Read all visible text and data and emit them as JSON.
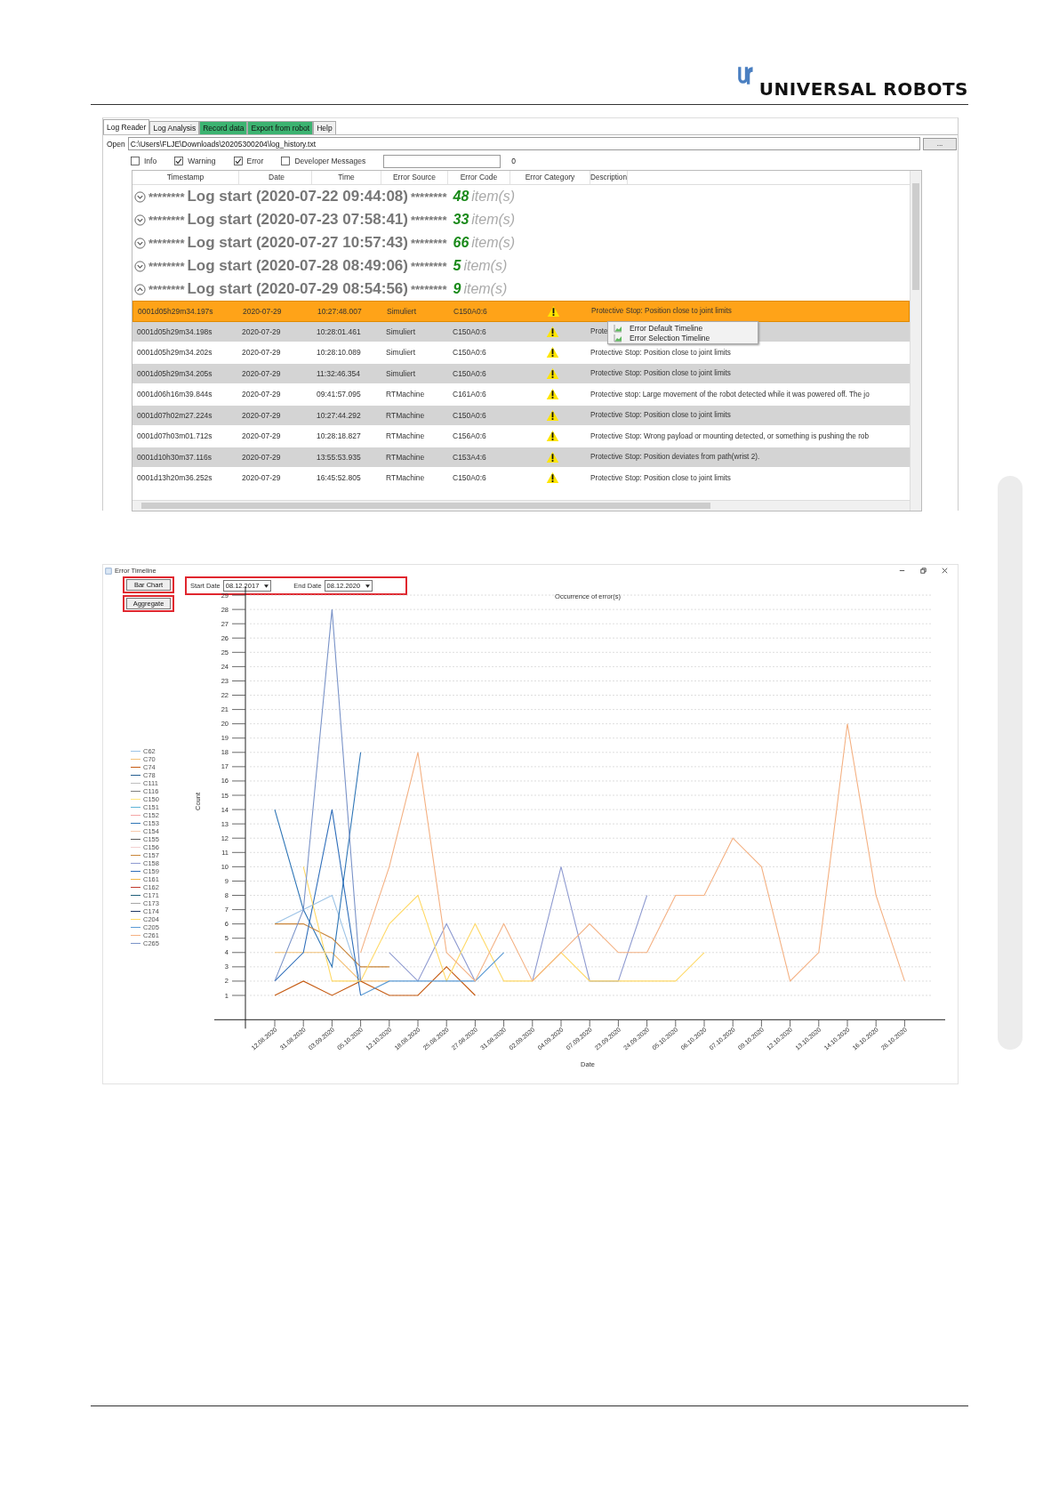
{
  "header": {
    "brand": "UNIVERSAL ROBOTS"
  },
  "log_reader": {
    "tabs": [
      {
        "label": "Log Reader",
        "selected": true,
        "kind": "plain"
      },
      {
        "label": "Log Analysis",
        "selected": false,
        "kind": "plain"
      },
      {
        "label": "Record data",
        "selected": false,
        "kind": "highlighted"
      },
      {
        "label": "Export from robot",
        "selected": false,
        "kind": "highlighted"
      },
      {
        "label": "Help",
        "selected": false,
        "kind": "plain"
      }
    ],
    "open_label": "Open",
    "path": "C:\\Users\\FLJE\\Downloads\\20205300204\\log_history.txt",
    "browse_button": "...",
    "filters": [
      {
        "label": "Info",
        "checked": false
      },
      {
        "label": "Warning",
        "checked": true
      },
      {
        "label": "Error",
        "checked": true
      },
      {
        "label": "Developer Messages",
        "checked": false
      }
    ],
    "message_count": "0",
    "columns": [
      "Timestamp",
      "Date",
      "Time",
      "Error Source",
      "Error Code",
      "Error Category",
      "Description"
    ],
    "groups": [
      {
        "stars_left": "********",
        "title": "Log start (2020-07-22 09:44:08)",
        "stars_right": "********",
        "count": "48",
        "unit": "item(s)",
        "expanded": false
      },
      {
        "stars_left": "********",
        "title": "Log start (2020-07-23 07:58:41)",
        "stars_right": "********",
        "count": "33",
        "unit": "item(s)",
        "expanded": false
      },
      {
        "stars_left": "********",
        "title": "Log start (2020-07-27 10:57:43)",
        "stars_right": "********",
        "count": "66",
        "unit": "item(s)",
        "expanded": false
      },
      {
        "stars_left": "********",
        "title": "Log start (2020-07-28 08:49:06)",
        "stars_right": "********",
        "count": "5",
        "unit": "item(s)",
        "expanded": false
      },
      {
        "stars_left": "********",
        "title": "Log start (2020-07-29 08:54:56)",
        "stars_right": "********",
        "count": "9",
        "unit": "item(s)",
        "expanded": true
      }
    ],
    "rows": [
      {
        "timestamp": "0001d05h29m34.197s",
        "date": "2020-07-29",
        "time": "10:27:48.007",
        "source": "Simuliert",
        "code": "C150A0:6",
        "description": "Protective Stop: Position close to joint limits",
        "selected": true
      },
      {
        "timestamp": "0001d05h29m34.198s",
        "date": "2020-07-29",
        "time": "10:28:01.461",
        "source": "Simuliert",
        "code": "C150A0:6",
        "description": "Prote",
        "selected": false
      },
      {
        "timestamp": "0001d05h29m34.202s",
        "date": "2020-07-29",
        "time": "10:28:10.089",
        "source": "Simuliert",
        "code": "C150A0:6",
        "description": "Protective Stop: Position close to joint limits",
        "selected": false
      },
      {
        "timestamp": "0001d05h29m34.205s",
        "date": "2020-07-29",
        "time": "11:32:46.354",
        "source": "Simuliert",
        "code": "C150A0:6",
        "description": "Protective Stop: Position close to joint limits",
        "selected": false
      },
      {
        "timestamp": "0001d06h16m39.844s",
        "date": "2020-07-29",
        "time": "09:41:57.095",
        "source": "RTMachine",
        "code": "C161A0:6",
        "description": "Protective stop: Large movement of the robot detected while it was powered off. The jo",
        "selected": false
      },
      {
        "timestamp": "0001d07h02m27.224s",
        "date": "2020-07-29",
        "time": "10:27:44.292",
        "source": "RTMachine",
        "code": "C150A0:6",
        "description": "Protective Stop: Position close to joint limits",
        "selected": false
      },
      {
        "timestamp": "0001d07h03m01.712s",
        "date": "2020-07-29",
        "time": "10:28:18.827",
        "source": "RTMachine",
        "code": "C156A0:6",
        "description": "Protective Stop: Wrong payload or mounting detected, or something is pushing the rob",
        "selected": false
      },
      {
        "timestamp": "0001d10h30m37.116s",
        "date": "2020-07-29",
        "time": "13:55:53.935",
        "source": "RTMachine",
        "code": "C153A4:6",
        "description": "Protective Stop: Position deviates from path(wrist 2).",
        "selected": false
      },
      {
        "timestamp": "0001d13h20m36.252s",
        "date": "2020-07-29",
        "time": "16:45:52.805",
        "source": "RTMachine",
        "code": "C150A0:6",
        "description": "Protective Stop: Position close to joint limits",
        "selected": false
      }
    ],
    "context_menu": [
      "Error Default Timeline",
      "Error Selection Timeline"
    ]
  },
  "error_timeline": {
    "title": "Error Timeline",
    "buttons": [
      "Bar Chart",
      "Aggregate"
    ],
    "start_label": "Start Date",
    "start_value": "08.12.2017",
    "end_label": "End Date",
    "end_value": "08.12.2020",
    "chart_data": {
      "type": "line",
      "title": "Occurrence of error(s)",
      "xlabel": "Date",
      "ylabel": "Count",
      "categories": [
        "12.08.2020",
        "31.08.2020",
        "03.09.2020",
        "05.10.2020",
        "12.10.2020",
        "18.08.2020",
        "25.08.2020",
        "27.08.2020",
        "31.08.2020",
        "02.09.2020",
        "04.09.2020",
        "07.09.2020",
        "23.09.2020",
        "24.09.2020",
        "05.10.2020",
        "06.10.2020",
        "07.10.2020",
        "09.10.2020",
        "12.10.2020",
        "13.10.2020",
        "14.10.2020",
        "16.10.2020",
        "26.10.2020"
      ],
      "ylim": [
        -0.7,
        29.6
      ],
      "grid": true,
      "yticks": [
        1,
        2,
        3,
        4,
        5,
        6,
        7,
        8,
        9,
        10,
        11,
        12,
        13,
        14,
        15,
        16,
        17,
        18,
        19,
        20,
        21,
        22,
        23,
        24,
        25,
        26,
        27,
        28,
        29
      ],
      "series": [
        {
          "name": "C62",
          "color": "#9dc3e6",
          "values": [
            6,
            7,
            8,
            2,
            null,
            null,
            null,
            null,
            null,
            null,
            null,
            null,
            null,
            null,
            null,
            null,
            null,
            null,
            null,
            null,
            null,
            null,
            null
          ]
        },
        {
          "name": "C70",
          "color": "#f4c27a",
          "values": [
            4,
            4,
            4,
            2,
            2,
            null,
            null,
            null,
            null,
            null,
            null,
            null,
            null,
            null,
            null,
            null,
            null,
            null,
            null,
            null,
            null,
            null,
            null
          ]
        },
        {
          "name": "C74",
          "color": "#c55a11",
          "values": [
            1,
            2,
            1,
            2,
            1,
            1,
            3,
            1,
            null,
            null,
            null,
            null,
            null,
            null,
            null,
            null,
            null,
            null,
            null,
            null,
            null,
            null,
            null
          ]
        },
        {
          "name": "C78",
          "color": "#255e91",
          "values": [
            null,
            null,
            null,
            null,
            null,
            null,
            null,
            null,
            null,
            null,
            null,
            null,
            null,
            null,
            null,
            null,
            null,
            null,
            null,
            null,
            null,
            null,
            null
          ]
        },
        {
          "name": "C111",
          "color": "#bfbfbf",
          "values": [
            null,
            null,
            null,
            null,
            null,
            null,
            null,
            null,
            null,
            null,
            null,
            null,
            null,
            null,
            null,
            null,
            null,
            null,
            null,
            null,
            null,
            null,
            null
          ]
        },
        {
          "name": "C116",
          "color": "#7f7f7f",
          "values": [
            null,
            null,
            null,
            null,
            null,
            null,
            null,
            null,
            null,
            null,
            null,
            null,
            null,
            null,
            null,
            null,
            null,
            null,
            null,
            null,
            null,
            null,
            null
          ]
        },
        {
          "name": "C150",
          "color": "#ffe680",
          "values": [
            null,
            null,
            null,
            null,
            null,
            null,
            null,
            null,
            null,
            null,
            null,
            null,
            null,
            null,
            null,
            null,
            null,
            null,
            null,
            null,
            null,
            null,
            null
          ]
        },
        {
          "name": "C151",
          "color": "#5fb4d6",
          "values": [
            null,
            null,
            null,
            null,
            null,
            null,
            null,
            null,
            null,
            null,
            null,
            null,
            null,
            null,
            null,
            null,
            null,
            null,
            null,
            null,
            null,
            null,
            null
          ]
        },
        {
          "name": "C152",
          "color": "#f4a6a6",
          "values": [
            null,
            null,
            null,
            null,
            null,
            null,
            null,
            null,
            null,
            null,
            null,
            null,
            null,
            null,
            null,
            null,
            null,
            null,
            null,
            null,
            null,
            null,
            null
          ]
        },
        {
          "name": "C153",
          "color": "#2e75b6",
          "values": [
            14,
            7,
            3,
            18,
            null,
            null,
            null,
            null,
            null,
            null,
            null,
            null,
            null,
            null,
            null,
            null,
            null,
            null,
            null,
            null,
            null,
            null,
            null
          ]
        },
        {
          "name": "C154",
          "color": "#f8cbad",
          "values": [
            null,
            null,
            null,
            null,
            null,
            null,
            null,
            null,
            null,
            null,
            null,
            null,
            null,
            null,
            null,
            null,
            null,
            null,
            null,
            null,
            null,
            null,
            null
          ]
        },
        {
          "name": "C155",
          "color": "#595959",
          "values": [
            null,
            null,
            null,
            null,
            null,
            null,
            null,
            null,
            null,
            null,
            null,
            null,
            null,
            null,
            null,
            null,
            null,
            null,
            null,
            null,
            null,
            null,
            null
          ]
        },
        {
          "name": "C156",
          "color": "#f2d0d0",
          "values": [
            null,
            null,
            null,
            null,
            null,
            null,
            null,
            null,
            null,
            null,
            null,
            null,
            null,
            null,
            null,
            null,
            null,
            null,
            null,
            null,
            null,
            null,
            null
          ]
        },
        {
          "name": "C157",
          "color": "#c9853a",
          "values": [
            6,
            6,
            5,
            3,
            3,
            null,
            null,
            null,
            null,
            null,
            null,
            null,
            null,
            null,
            null,
            null,
            null,
            null,
            null,
            null,
            null,
            null,
            null
          ]
        },
        {
          "name": "C158",
          "color": "#8e9ad0",
          "values": [
            null,
            null,
            null,
            null,
            4,
            2,
            6,
            2,
            null,
            2,
            10,
            2,
            2,
            8,
            null,
            null,
            null,
            null,
            null,
            null,
            null,
            null,
            null
          ]
        },
        {
          "name": "C159",
          "color": "#2f6eba",
          "values": [
            2,
            4,
            14,
            1,
            null,
            null,
            null,
            null,
            null,
            null,
            null,
            null,
            null,
            null,
            null,
            null,
            null,
            null,
            null,
            null,
            null,
            null,
            null
          ]
        },
        {
          "name": "C161",
          "color": "#f0b84a",
          "values": [
            null,
            null,
            null,
            null,
            null,
            null,
            null,
            null,
            null,
            null,
            null,
            null,
            null,
            null,
            null,
            null,
            null,
            null,
            null,
            null,
            null,
            null,
            null
          ]
        },
        {
          "name": "C162",
          "color": "#c0392b",
          "values": [
            null,
            null,
            null,
            null,
            null,
            null,
            null,
            null,
            null,
            null,
            null,
            null,
            null,
            null,
            null,
            null,
            null,
            null,
            null,
            null,
            null,
            null,
            null
          ]
        },
        {
          "name": "C171",
          "color": "#1f5f7a",
          "values": [
            null,
            null,
            null,
            null,
            null,
            null,
            null,
            null,
            null,
            null,
            null,
            null,
            null,
            null,
            null,
            null,
            null,
            null,
            null,
            null,
            null,
            null,
            null
          ]
        },
        {
          "name": "C173",
          "color": "#a6a6a6",
          "values": [
            null,
            null,
            null,
            null,
            null,
            null,
            null,
            null,
            null,
            null,
            null,
            null,
            null,
            null,
            null,
            null,
            null,
            null,
            null,
            null,
            null,
            null,
            null
          ]
        },
        {
          "name": "C174",
          "color": "#203864",
          "values": [
            null,
            null,
            null,
            null,
            null,
            null,
            null,
            null,
            null,
            null,
            null,
            null,
            null,
            null,
            null,
            null,
            null,
            null,
            null,
            null,
            null,
            null,
            null
          ]
        },
        {
          "name": "C204",
          "color": "#ffd966",
          "values": [
            null,
            10,
            2,
            2,
            6,
            8,
            2,
            6,
            2,
            2,
            4,
            2,
            2,
            2,
            2,
            4,
            null,
            null,
            null,
            null,
            null,
            null,
            null
          ]
        },
        {
          "name": "C205",
          "color": "#5b9bd5",
          "values": [
            null,
            null,
            null,
            1,
            2,
            2,
            2,
            2,
            4,
            null,
            null,
            null,
            null,
            null,
            null,
            null,
            null,
            null,
            null,
            null,
            null,
            null,
            null
          ]
        },
        {
          "name": "C261",
          "color": "#f4b183",
          "values": [
            null,
            null,
            null,
            4,
            10,
            18,
            4,
            2,
            6,
            2,
            4,
            6,
            4,
            4,
            8,
            8,
            12,
            10,
            2,
            4,
            20,
            8,
            2
          ]
        },
        {
          "name": "C265",
          "color": "#7a93c8",
          "values": [
            2,
            7,
            28,
            2,
            null,
            null,
            null,
            null,
            null,
            null,
            null,
            null,
            null,
            null,
            null,
            null,
            null,
            null,
            null,
            null,
            null,
            null,
            null
          ]
        }
      ]
    }
  }
}
